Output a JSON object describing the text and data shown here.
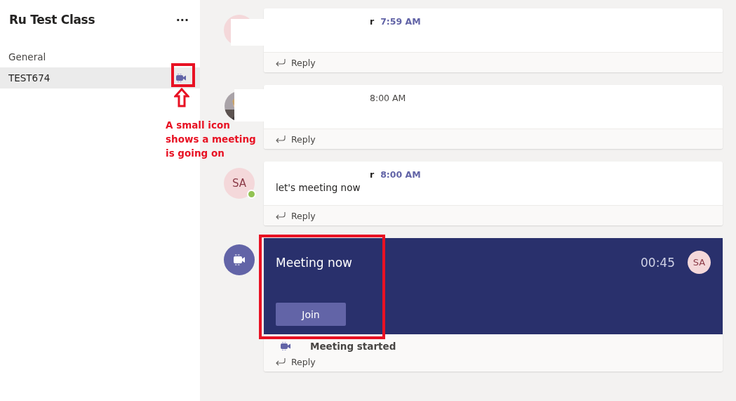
{
  "sidebar": {
    "title": "Ru Test Class",
    "more": "···",
    "channels": [
      {
        "name": "General",
        "selected": false,
        "meeting": false
      },
      {
        "name": "TEST674",
        "selected": true,
        "meeting": true
      }
    ]
  },
  "posts": [
    {
      "kind": "message",
      "avatar": {
        "kind": "initials"
      },
      "sender": "r",
      "time": "7:59 AM",
      "time_bold": true,
      "reply": "Reply"
    },
    {
      "kind": "message",
      "time": "8:00 AM",
      "time_bold": false,
      "reply": "Reply"
    },
    {
      "kind": "message",
      "avatar": {
        "kind": "initials",
        "initials": "SA",
        "online": true
      },
      "sender": "r",
      "time": "8:00 AM",
      "time_bold": true,
      "text": "let's meeting now",
      "reply": "Reply"
    },
    {
      "kind": "meeting",
      "avatar": {
        "kind": "meeting"
      },
      "title": "Meeting now",
      "duration": "00:45",
      "participant": "SA",
      "join": "Join",
      "status": "Meeting started",
      "reply": "Reply"
    }
  ],
  "annotation": {
    "text": "A small icon shows a meeting is going on"
  }
}
